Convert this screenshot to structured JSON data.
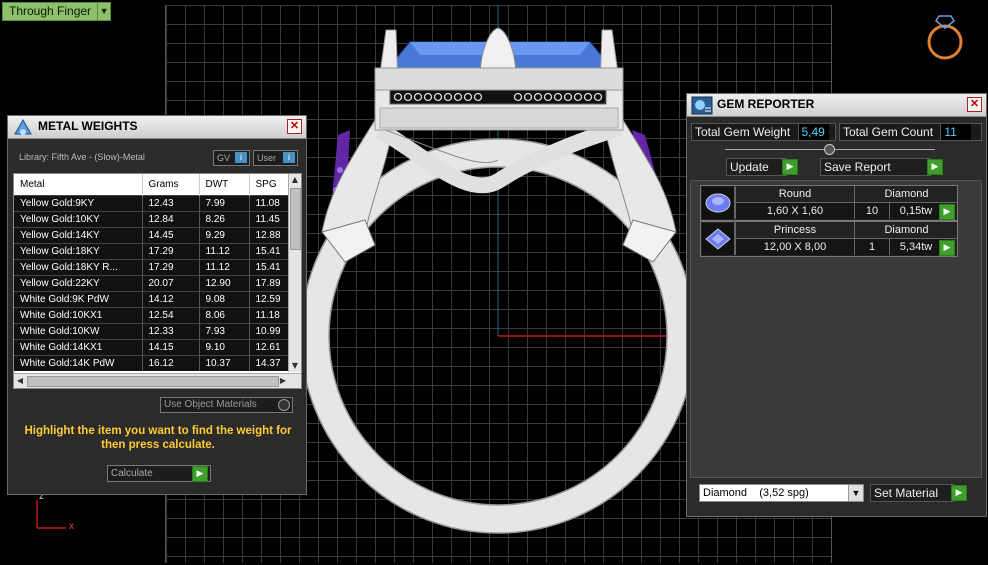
{
  "viewport": {
    "view_name": "Through Finger",
    "axis_z": "z",
    "axis_x": "x"
  },
  "metal_weights": {
    "title": "METAL WEIGHTS",
    "library": "Library: Fifth Ave - (Slow)-Metal",
    "toggle_gv": "GV",
    "toggle_user": "User",
    "columns": [
      "Metal",
      "Grams",
      "DWT",
      "SPG"
    ],
    "rows": [
      [
        "Yellow Gold:9KY",
        "12.43",
        "7.99",
        "11.08"
      ],
      [
        "Yellow Gold:10KY",
        "12.84",
        "8.26",
        "11.45"
      ],
      [
        "Yellow Gold:14KY",
        "14.45",
        "9.29",
        "12.88"
      ],
      [
        "Yellow Gold:18KY",
        "17.29",
        "11.12",
        "15.41"
      ],
      [
        "Yellow Gold:18KY R...",
        "17.29",
        "11.12",
        "15.41"
      ],
      [
        "Yellow Gold:22KY",
        "20.07",
        "12.90",
        "17.89"
      ],
      [
        "White Gold:9K PdW",
        "14.12",
        "9.08",
        "12.59"
      ],
      [
        "White Gold:10KX1",
        "12.54",
        "8.06",
        "11.18"
      ],
      [
        "White Gold:10KW",
        "12.33",
        "7.93",
        "10.99"
      ],
      [
        "White Gold:14KX1",
        "14.15",
        "9.10",
        "12.61"
      ],
      [
        "White Gold:14K PdW",
        "16.12",
        "10.37",
        "14.37"
      ]
    ],
    "use_object_materials": "Use Object Materials",
    "hint": "Highlight the item you want to find the weight for then press calculate.",
    "calculate_label": "Calculate"
  },
  "gem_reporter": {
    "title": "GEM REPORTER",
    "total_weight_label": "Total Gem Weight",
    "total_weight_value": "5,49",
    "total_count_label": "Total Gem Count",
    "total_count_value": "11",
    "update_label": "Update",
    "save_report_label": "Save Report",
    "gems": [
      {
        "cut": "Round",
        "type": "Diamond",
        "size": "1,60 X 1,60",
        "count": "10",
        "weight": "0,15tw",
        "icon": "round-gem-icon"
      },
      {
        "cut": "Princess",
        "type": "Diamond",
        "size": "12,00 X 8,00",
        "count": "1",
        "weight": "5,34tw",
        "icon": "princess-gem-icon"
      }
    ],
    "material": "Diamond",
    "material_spg": "(3,52 spg)",
    "set_material_label": "Set Material"
  },
  "colors": {
    "accent_green": "#3ea02a",
    "view_label": "#8cc06a",
    "hint_yellow": "#ffcc33",
    "value_cyan": "#4fd0ff",
    "gem_blue": "#4a78d8",
    "gem_purple": "#8a4fd8"
  }
}
